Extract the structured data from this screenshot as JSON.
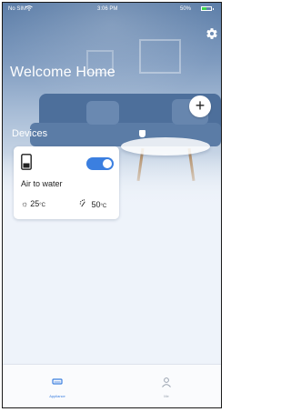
{
  "status_bar": {
    "carrier": "No SIM",
    "time": "3:06 PM",
    "battery_percent": "50%",
    "battery_level": 0.5,
    "wifi_icon": "wifi-icon"
  },
  "header": {
    "title": "Welcome Home",
    "settings_icon": "gear-icon",
    "add_icon": "plus-icon"
  },
  "devices": {
    "section_label": "Devices",
    "items": [
      {
        "name": "Air to water",
        "power_on": true,
        "temp_heat": "25",
        "temp_water": "50",
        "unit": "°C",
        "icon": "heat-pump-icon"
      }
    ]
  },
  "tabs": [
    {
      "label": "Appliance",
      "icon": "appliance-icon",
      "active": true
    },
    {
      "label": "Me",
      "icon": "user-icon",
      "active": false
    }
  ],
  "colors": {
    "accent": "#3b7fe0",
    "battery_fill": "#3dd44f"
  }
}
